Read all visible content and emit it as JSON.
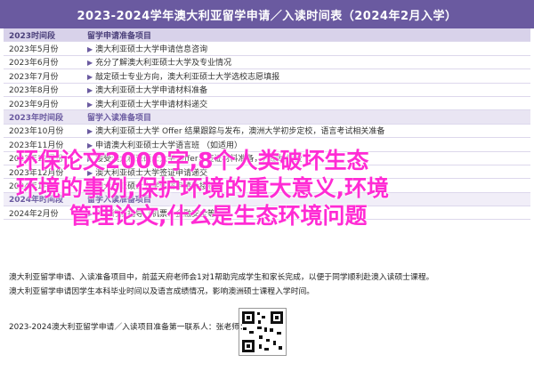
{
  "title": "2023-2024学年澳大利亚留学申请／入读时间表（2024年2月入学）",
  "header": {
    "col1": "2023时间段",
    "col2": "留学申请准备项目"
  },
  "rows": [
    {
      "time": "2023年5月份",
      "item": "澳大利亚硕士大学申请信息咨询"
    },
    {
      "time": "2023年6月份",
      "item": "充分了解澳大利亚硕士大学及专业情况"
    },
    {
      "time": "2023年7月份",
      "item": "敲定硕士专业方向，澳大利亚硕士大学选校志愿填报"
    },
    {
      "time": "2023年8月份",
      "item": "澳大利亚硕士大学申请材料准备"
    },
    {
      "time": "2023年9月份",
      "item": "澳大利亚硕士大学申请材料递交"
    }
  ],
  "sub_header": {
    "col1": "2023年时间段",
    "col2": "留学入读准备项目"
  },
  "rows2": [
    {
      "time": "2023年10月份",
      "item": "澳大利亚硕士大学 Offer 结果跟踪与发布，澳洲大学初步定校，语言考试相关准备"
    },
    {
      "time": "2023年11月份",
      "item": "申请澳大利亚硕士大学语言班 （如适用）"
    },
    {
      "time": "2023年12月份",
      "item": "接受澳大利亚硕士大学 Offer，签证材料准备，并缴纳学费"
    },
    {
      "time": "2023年12月份",
      "item": "澳大利亚硕士大学签证申请递交"
    },
    {
      "time": "2024年1月份",
      "item": "澳大利亚硕士大学住宿申请及接机"
    }
  ],
  "section3": {
    "col1": "2024年时间段",
    "col2": "留学入读准备项目"
  },
  "rows3": [
    {
      "time": "2024年2月份",
      "item": "入读行前指导（机票、金融安全等）"
    }
  ],
  "overlay": {
    "line1": "环保论文2000字,8个人类破坏生态",
    "line2": "环境的事例,保护环境的重大意义,环境",
    "line3": "管理论文,什么是生态环境问题"
  },
  "notes": [
    "澳大利亚留学申请、入读准备项目中，前蓝天府老师会1对1帮助完成学生和家长完成，以便于同学顺利赴澳入读硕士课程。",
    "澳大利亚留学申请因学生本科毕业时间以及语言成绩情况，影响澳洲硕士课程入学时间。"
  ],
  "footer": "2023-2024澳大利亚留学申请／入读项目准备第一联系人：张老师：",
  "colors": {
    "accent": "#6a5aa0",
    "overlay": "#ff2bd4"
  }
}
